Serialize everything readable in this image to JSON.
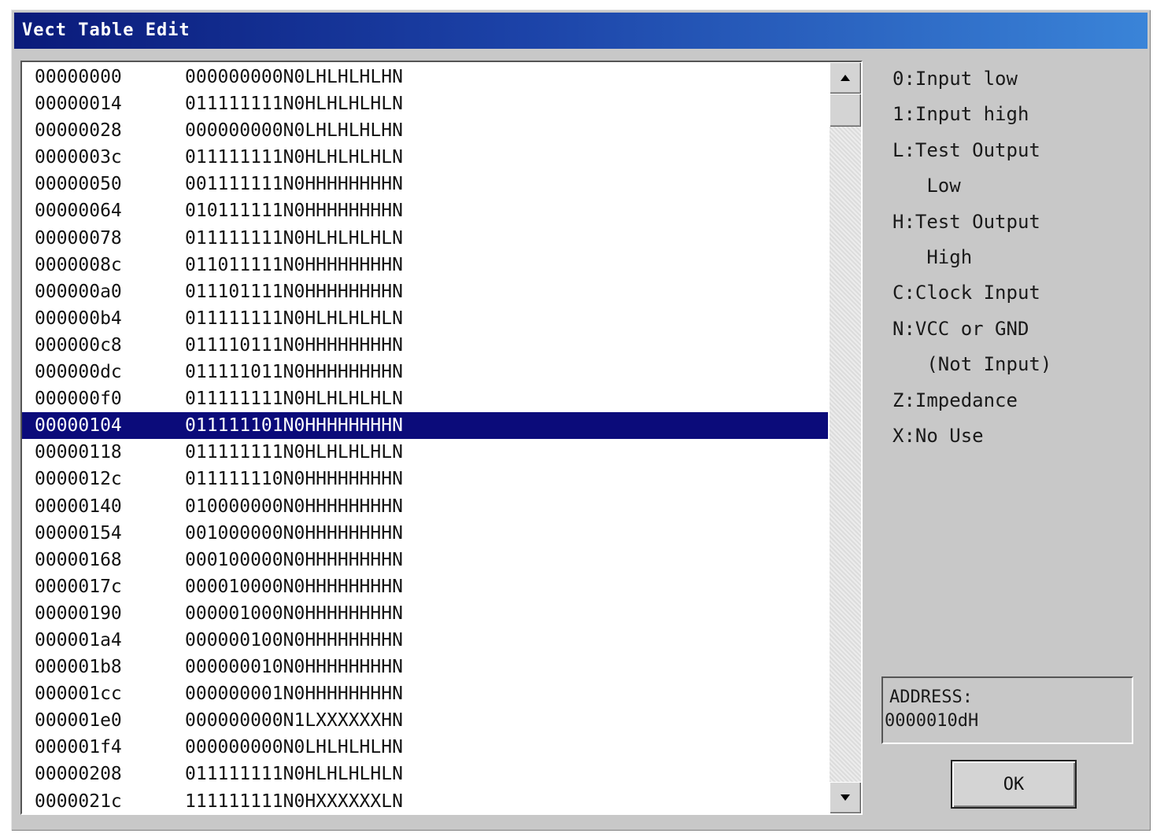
{
  "window": {
    "title": "Vect Table Edit"
  },
  "rows": [
    {
      "address": "00000000",
      "vector": "000000000N0LHLHLHLHN"
    },
    {
      "address": "00000014",
      "vector": "011111111N0HLHLHLHLN"
    },
    {
      "address": "00000028",
      "vector": "000000000N0LHLHLHLHN"
    },
    {
      "address": "0000003c",
      "vector": "011111111N0HLHLHLHLN"
    },
    {
      "address": "00000050",
      "vector": "001111111N0HHHHHHHHN"
    },
    {
      "address": "00000064",
      "vector": "010111111N0HHHHHHHHN"
    },
    {
      "address": "00000078",
      "vector": "011111111N0HLHLHLHLN"
    },
    {
      "address": "0000008c",
      "vector": "011011111N0HHHHHHHHN"
    },
    {
      "address": "000000a0",
      "vector": "011101111N0HHHHHHHHN"
    },
    {
      "address": "000000b4",
      "vector": "011111111N0HLHLHLHLN"
    },
    {
      "address": "000000c8",
      "vector": "011110111N0HHHHHHHHN"
    },
    {
      "address": "000000dc",
      "vector": "011111011N0HHHHHHHHN"
    },
    {
      "address": "000000f0",
      "vector": "011111111N0HLHLHLHLN"
    },
    {
      "address": "00000104",
      "vector": "011111101N0HHHHHHHHN"
    },
    {
      "address": "00000118",
      "vector": "011111111N0HLHLHLHLN"
    },
    {
      "address": "0000012c",
      "vector": "011111110N0HHHHHHHHN"
    },
    {
      "address": "00000140",
      "vector": "010000000N0HHHHHHHHN"
    },
    {
      "address": "00000154",
      "vector": "001000000N0HHHHHHHHN"
    },
    {
      "address": "00000168",
      "vector": "000100000N0HHHHHHHHN"
    },
    {
      "address": "0000017c",
      "vector": "000010000N0HHHHHHHHN"
    },
    {
      "address": "00000190",
      "vector": "000001000N0HHHHHHHHN"
    },
    {
      "address": "000001a4",
      "vector": "000000100N0HHHHHHHHN"
    },
    {
      "address": "000001b8",
      "vector": "000000010N0HHHHHHHHN"
    },
    {
      "address": "000001cc",
      "vector": "000000001N0HHHHHHHHN"
    },
    {
      "address": "000001e0",
      "vector": "000000000N1LXXXXXXHN"
    },
    {
      "address": "000001f4",
      "vector": "000000000N0LHLHLHLHN"
    },
    {
      "address": "00000208",
      "vector": "011111111N0HLHLHLHLN"
    },
    {
      "address": "0000021c",
      "vector": "111111111N0HXXXXXXLN"
    }
  ],
  "selected_row_address": "00000104",
  "legend": [
    "0:Input low",
    "1:Input high",
    "L:Test Output",
    "   Low",
    "H:Test Output",
    "   High",
    "C:Clock Input",
    "N:VCC or GND",
    "   (Not Input)",
    "Z:Impedance",
    "X:No Use"
  ],
  "address_box": {
    "label": "ADDRESS:",
    "value": "0000010dH"
  },
  "ok_button": {
    "label": "OK"
  },
  "icons": {
    "scroll_up": "triangle-up",
    "scroll_down": "triangle-down"
  },
  "colors": {
    "selection": "#0b0b7a",
    "title_start": "#0a1a7a",
    "title_end": "#3a84d8",
    "face": "#c8c8c8"
  }
}
